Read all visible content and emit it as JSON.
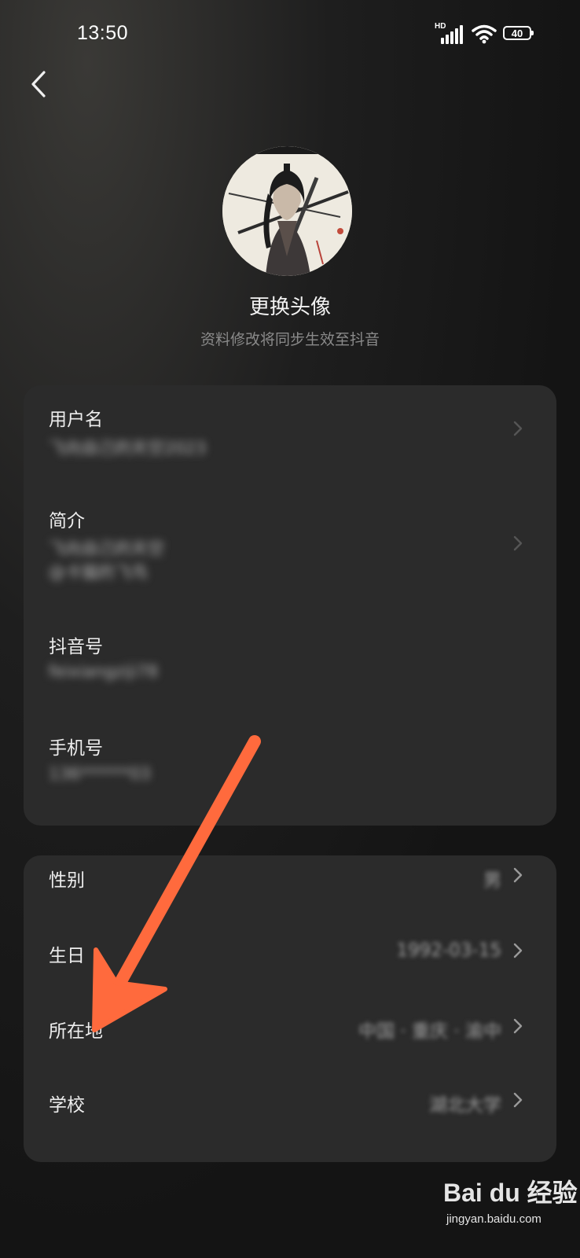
{
  "status_bar": {
    "time": "13:50",
    "network": "HD",
    "battery": "40"
  },
  "header": {
    "back_icon": "chevron-left-icon"
  },
  "profile": {
    "change_avatar_label": "更换头像",
    "sync_notice": "资料修改将同步生效至抖音"
  },
  "account_card": {
    "rows": [
      {
        "label": "用户名",
        "value": "飞向自己的天空2023"
      },
      {
        "label": "简介",
        "value_line1": "飞向自己的天空",
        "value_line2": "@卡猫的飞鸟"
      },
      {
        "label": "抖音号",
        "value": "feixiangziji78"
      },
      {
        "label": "手机号",
        "value": "136******03"
      }
    ]
  },
  "info_card": {
    "rows": [
      {
        "label": "性别",
        "value": "男"
      },
      {
        "label": "生日",
        "value": "1992-03-15"
      },
      {
        "label": "所在地",
        "value": "中国 · 重庆 · 渝中"
      },
      {
        "label": "学校",
        "value": "湖北大学"
      }
    ]
  },
  "annotation": {
    "arrow_color": "#ff6a3d"
  },
  "watermark": {
    "logo": "Bai du 经验",
    "url": "jingyan.baidu.com"
  },
  "colors": {
    "background": "#161616",
    "card": "#2b2b2b",
    "text_primary": "#ededed",
    "text_secondary": "#8a8a8a"
  }
}
